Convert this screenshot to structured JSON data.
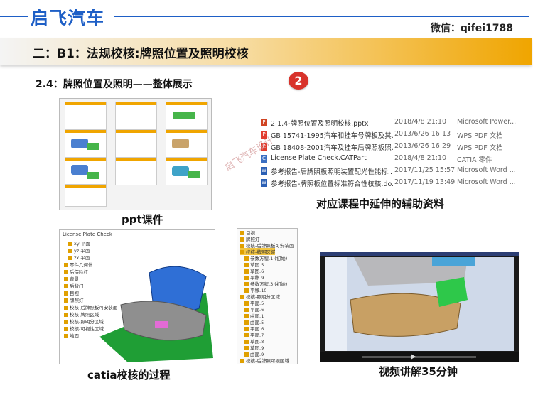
{
  "brand": "启飞汽车",
  "wechat": "微信：qifei1788",
  "banner_title": "二：B1：法规校核:牌照位置及照明校核",
  "section_title": "2.4：牌照位置及照明——整体展示",
  "badge_number": "2",
  "watermark": "启飞汽车设计",
  "captions": {
    "ppt": "ppt课件",
    "resources": "对应课程中延伸的辅助资料",
    "catia": "catia校核的过程",
    "video": "视频讲解35分钟"
  },
  "files": [
    {
      "name": "2.1.4-牌照位置及照明校核.pptx",
      "date": "2018/4/8 21:10",
      "type": "Microsoft Power...",
      "icon": "ppt-icon",
      "color": "#d04423"
    },
    {
      "name": "GB 15741-1995汽车和挂车号牌板及其...",
      "date": "2013/6/26 16:13",
      "type": "WPS PDF 文档",
      "icon": "pdf-icon",
      "color": "#e23b2e"
    },
    {
      "name": "GB 18408-2001汽车及挂车后牌照板照...",
      "date": "2013/6/26 16:29",
      "type": "WPS PDF 文档",
      "icon": "pdf-icon",
      "color": "#e23b2e"
    },
    {
      "name": "License Plate Check.CATPart",
      "date": "2018/4/8 21:10",
      "type": "CATIA 零件",
      "icon": "catpart-icon",
      "color": "#3b6fc2"
    },
    {
      "name": "参考报告-后牌照板照明装置配光性能标...",
      "date": "2017/11/25 15:57",
      "type": "Microsoft Word ...",
      "icon": "word-icon",
      "color": "#2b5fb4"
    },
    {
      "name": "参考报告-牌照板位置标准符合性校核.do...",
      "date": "2017/11/19 13:49",
      "type": "Microsoft Word ...",
      "icon": "word-icon",
      "color": "#2b5fb4"
    }
  ],
  "catia_tree": {
    "root": "License Plate Check",
    "items": [
      "xy 平面",
      "yz 平面",
      "zx 平面",
      "零件几何体",
      "后保险杠",
      "背景",
      "后背门",
      "目视",
      "牌照灯",
      "校核-后牌照板可安装面",
      "校核-牌照区域",
      "校核-照明分区域",
      "校核-可视性区域",
      "地面"
    ]
  },
  "tree2": {
    "items": [
      "目视",
      "牌照灯",
      "校核-后牌照板可安装面",
      "校核-牌照区域",
      "参数方程.1 (初始)",
      "草图.5",
      "草图.6",
      "平移.9",
      "参数方程.3 (初始)",
      "平移.10",
      "校核-照明分区域",
      "平面.5",
      "平面.6",
      "曲面.1",
      "曲面.5",
      "平面.6",
      "平面.7",
      "草图.8",
      "草图.9",
      "曲面.9",
      "校核-后牌照可视区域"
    ]
  }
}
